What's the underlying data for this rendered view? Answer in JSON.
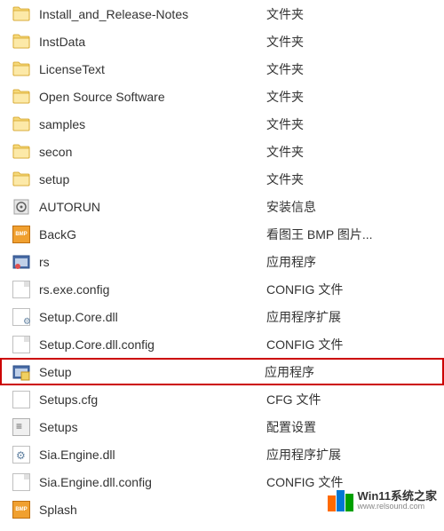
{
  "files": [
    {
      "name": "Install_and_Release-Notes",
      "type": "文件夹",
      "icon": "folder",
      "highlight": false
    },
    {
      "name": "InstData",
      "type": "文件夹",
      "icon": "folder",
      "highlight": false
    },
    {
      "name": "LicenseText",
      "type": "文件夹",
      "icon": "folder",
      "highlight": false
    },
    {
      "name": "Open Source Software",
      "type": "文件夹",
      "icon": "folder",
      "highlight": false
    },
    {
      "name": "samples",
      "type": "文件夹",
      "icon": "folder",
      "highlight": false
    },
    {
      "name": "secon",
      "type": "文件夹",
      "icon": "folder",
      "highlight": false
    },
    {
      "name": "setup",
      "type": "文件夹",
      "icon": "folder",
      "highlight": false
    },
    {
      "name": "AUTORUN",
      "type": "安装信息",
      "icon": "autorun",
      "highlight": false
    },
    {
      "name": "BackG",
      "type": "看图王 BMP 图片...",
      "icon": "bmp",
      "highlight": false
    },
    {
      "name": "rs",
      "type": "应用程序",
      "icon": "exe",
      "highlight": false
    },
    {
      "name": "rs.exe.config",
      "type": "CONFIG 文件",
      "icon": "config",
      "highlight": false
    },
    {
      "name": "Setup.Core.dll",
      "type": "应用程序扩展",
      "icon": "dll",
      "highlight": false
    },
    {
      "name": "Setup.Core.dll.config",
      "type": "CONFIG 文件",
      "icon": "config",
      "highlight": false
    },
    {
      "name": "Setup",
      "type": "应用程序",
      "icon": "setup-exe",
      "highlight": true
    },
    {
      "name": "Setups.cfg",
      "type": "CFG 文件",
      "icon": "cfg",
      "highlight": false
    },
    {
      "name": "Setups",
      "type": "配置设置",
      "icon": "settings",
      "highlight": false
    },
    {
      "name": "Sia.Engine.dll",
      "type": "应用程序扩展",
      "icon": "engine",
      "highlight": false
    },
    {
      "name": "Sia.Engine.dll.config",
      "type": "CONFIG 文件",
      "icon": "config",
      "highlight": false
    },
    {
      "name": "Splash",
      "type": "",
      "icon": "bmp",
      "highlight": false
    }
  ],
  "watermark": {
    "title": "Win11系统之家",
    "url": "www.relsound.com"
  }
}
